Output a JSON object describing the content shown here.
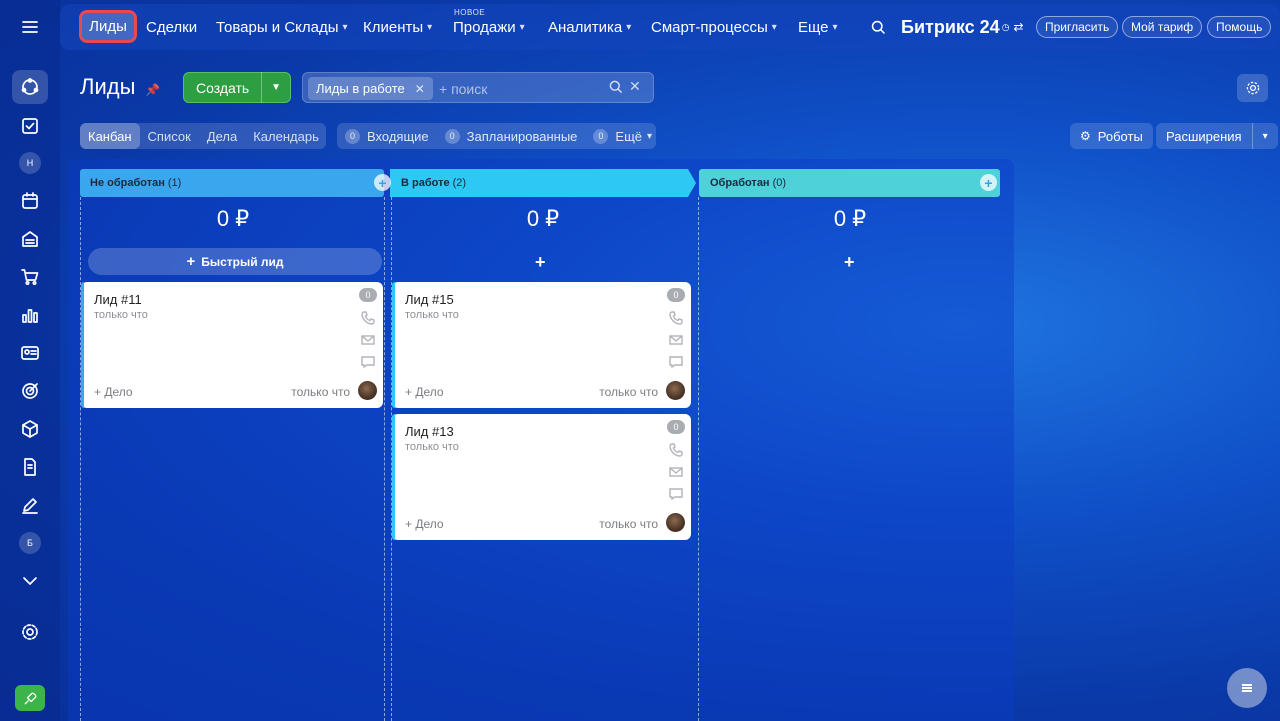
{
  "nav": {
    "items": [
      {
        "label": "Лиды",
        "chevron": false
      },
      {
        "label": "Сделки",
        "chevron": false
      },
      {
        "label": "Товары и Склады",
        "chevron": true
      },
      {
        "label": "Клиенты",
        "chevron": true
      },
      {
        "label": "Продажи",
        "chevron": true
      },
      {
        "label": "Аналитика",
        "chevron": true
      },
      {
        "label": "Смарт-процессы",
        "chevron": true
      },
      {
        "label": "Еще",
        "chevron": true
      }
    ],
    "new_badge": "НОВОЕ",
    "brand": "Битрикс 24",
    "invite": "Пригласить",
    "tariff": "Мой тариф",
    "help": "Помощь"
  },
  "sidebar": {
    "letters": [
      "Н",
      "Б"
    ]
  },
  "header": {
    "title": "Лиды",
    "create": "Создать",
    "filter_chip": "Лиды в работе",
    "search_placeholder": "+ поиск"
  },
  "views": {
    "tabs": [
      "Канбан",
      "Список",
      "Дела",
      "Календарь"
    ],
    "counters": [
      {
        "num": "0",
        "label": "Входящие"
      },
      {
        "num": "0",
        "label": "Запланированные"
      },
      {
        "num": "0",
        "label": "Ещё"
      }
    ],
    "robots": "Роботы",
    "extensions": "Расширения"
  },
  "columns": [
    {
      "title": "Не обработан",
      "count": "(1)",
      "sum": "0 ₽",
      "color": "#3aa6ee"
    },
    {
      "title": "В работе",
      "count": "(2)",
      "sum": "0 ₽",
      "color": "#2ec8f4"
    },
    {
      "title": "Обработан",
      "count": "(0)",
      "sum": "0 ₽",
      "color": "#4fd1d9"
    }
  ],
  "quick_lead": "Быстрый лид",
  "cards": [
    {
      "title": "Лид #11",
      "sub": "только что",
      "badge": "0",
      "deal": "+ Дело",
      "time": "только что"
    },
    {
      "title": "Лид #15",
      "sub": "только что",
      "badge": "0",
      "deal": "+ Дело",
      "time": "только что"
    },
    {
      "title": "Лид #13",
      "sub": "только что",
      "badge": "0",
      "deal": "+ Дело",
      "time": "только что"
    }
  ]
}
